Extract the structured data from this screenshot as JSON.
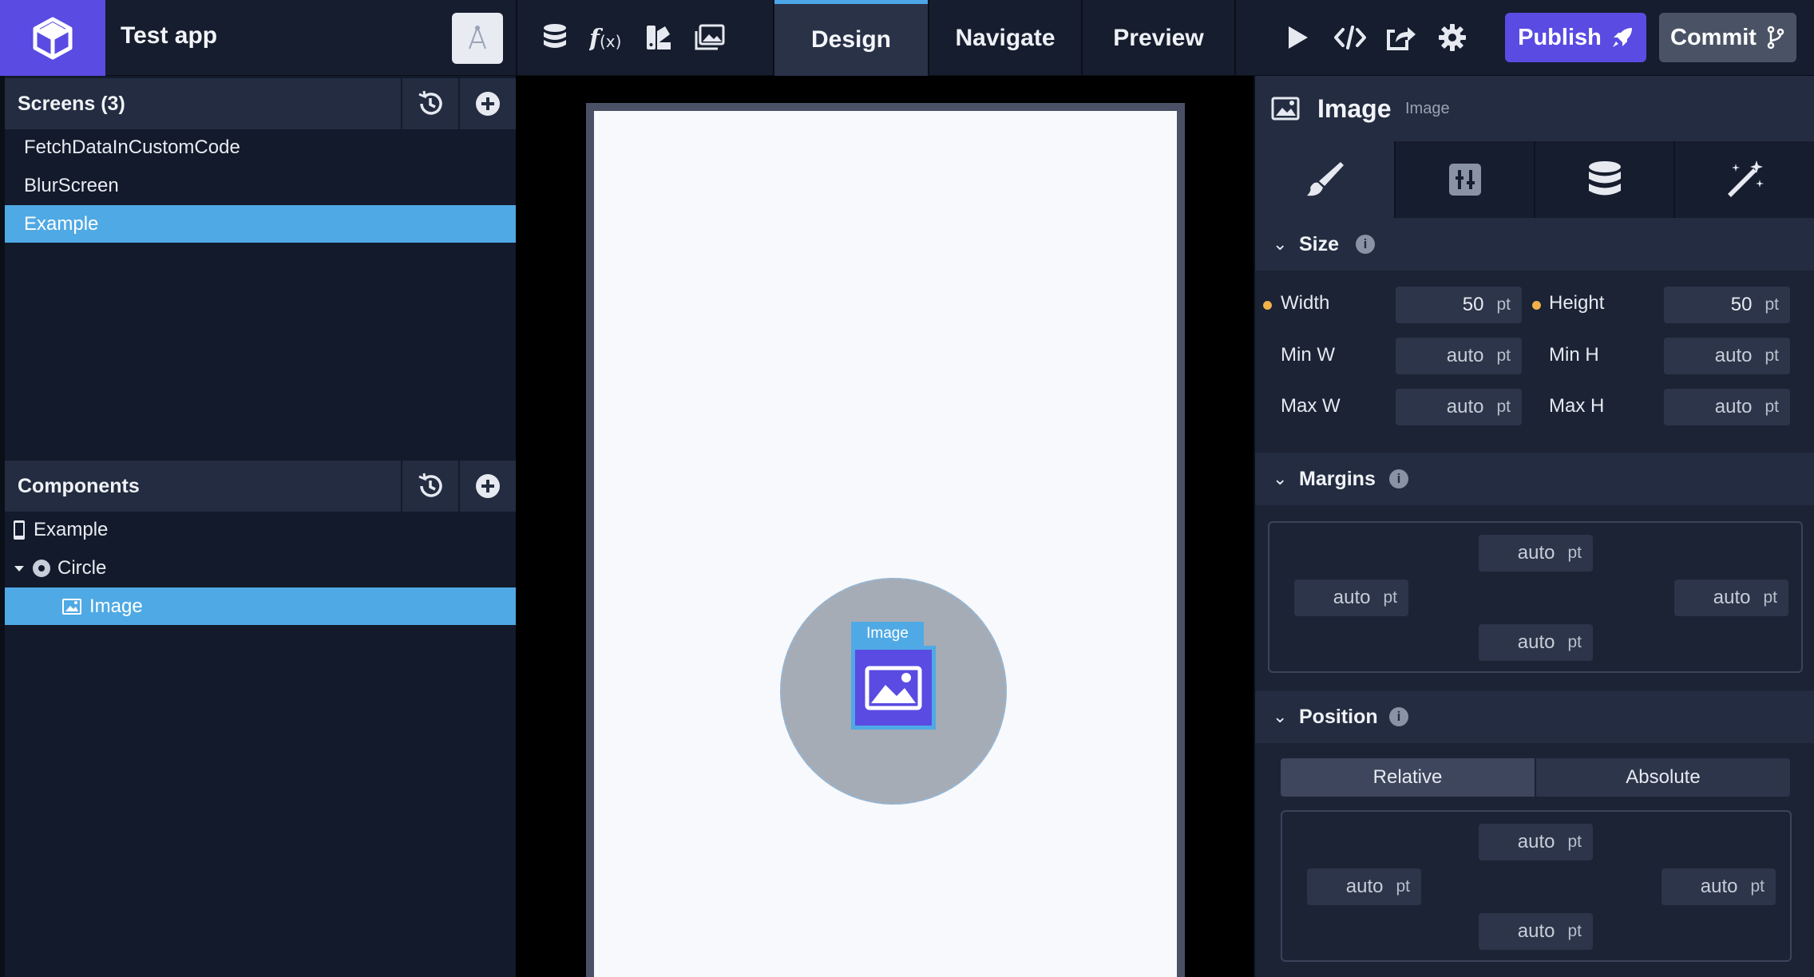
{
  "app": {
    "name": "Test app"
  },
  "toolbar": {
    "tools": [
      "database-icon",
      "function-icon",
      "theme-icon",
      "media-icon"
    ],
    "tabs": [
      {
        "label": "Design",
        "active": true
      },
      {
        "label": "Navigate",
        "active": false
      },
      {
        "label": "Preview",
        "active": false
      }
    ],
    "actions": [
      "play-icon",
      "code-icon",
      "share-icon",
      "settings-icon"
    ],
    "publish_label": "Publish",
    "commit_label": "Commit"
  },
  "screens": {
    "title": "Screens (3)",
    "items": [
      {
        "label": "FetchDataInCustomCode",
        "selected": false
      },
      {
        "label": "BlurScreen",
        "selected": false
      },
      {
        "label": "Example",
        "selected": true
      }
    ]
  },
  "components": {
    "title": "Components",
    "tree": [
      {
        "label": "Example",
        "icon": "phone-icon",
        "selected": false
      },
      {
        "label": "Circle",
        "icon": "circle-icon",
        "selected": false,
        "expanded": true
      },
      {
        "label": "Image",
        "icon": "image-icon",
        "selected": true
      }
    ]
  },
  "canvas": {
    "selected_label": "Image"
  },
  "inspector": {
    "title": "Image",
    "subtitle": "Image",
    "tabs": [
      "brush-icon",
      "layout-icon",
      "database-icon",
      "magic-wand-icon"
    ],
    "size": {
      "title": "Size",
      "width_label": "Width",
      "width_value": "50",
      "width_unit": "pt",
      "height_label": "Height",
      "height_value": "50",
      "height_unit": "pt",
      "minw_label": "Min W",
      "minw_value": "auto",
      "minw_unit": "pt",
      "minh_label": "Min H",
      "minh_value": "auto",
      "minh_unit": "pt",
      "maxw_label": "Max W",
      "maxw_value": "auto",
      "maxw_unit": "pt",
      "maxh_label": "Max H",
      "maxh_value": "auto",
      "maxh_unit": "pt"
    },
    "margins": {
      "title": "Margins",
      "top": "auto",
      "left": "auto",
      "right": "auto",
      "bottom": "auto",
      "unit": "pt"
    },
    "position": {
      "title": "Position",
      "modes": [
        "Relative",
        "Absolute"
      ],
      "active_mode": "Relative",
      "top": "auto",
      "left": "auto",
      "right": "auto",
      "bottom": "auto",
      "unit": "pt"
    }
  },
  "colors": {
    "accent": "#5a4be3",
    "selection": "#4fa9e4",
    "changed_dot": "#f1b24a"
  }
}
